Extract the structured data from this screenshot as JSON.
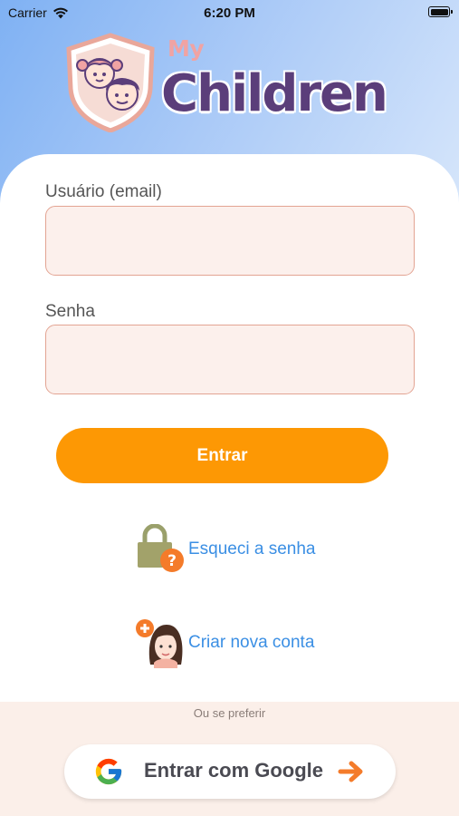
{
  "status_bar": {
    "carrier": "Carrier",
    "time": "6:20 PM"
  },
  "logo": {
    "my": "My",
    "children": "Children"
  },
  "form": {
    "email_label": "Usuário (email)",
    "email_value": "",
    "password_label": "Senha",
    "password_value": "",
    "submit_label": "Entrar"
  },
  "links": {
    "forgot_password": "Esqueci a senha",
    "create_account": "Criar nova conta"
  },
  "alt_login": {
    "or_text": "Ou se preferir",
    "google_label": "Entrar com Google"
  },
  "colors": {
    "primary_orange": "#fd9804",
    "link_blue": "#3b8fe4",
    "input_bg": "#fcf0ec",
    "input_border": "#e3a493",
    "brand_purple": "#5b3e7a",
    "brand_pink": "#f0a3a3"
  },
  "icons": {
    "wifi": "wifi-icon",
    "battery": "battery-icon",
    "lock": "lock-question-icon",
    "avatar": "add-user-avatar-icon",
    "google": "google-g-icon",
    "arrow": "arrow-right-icon"
  }
}
